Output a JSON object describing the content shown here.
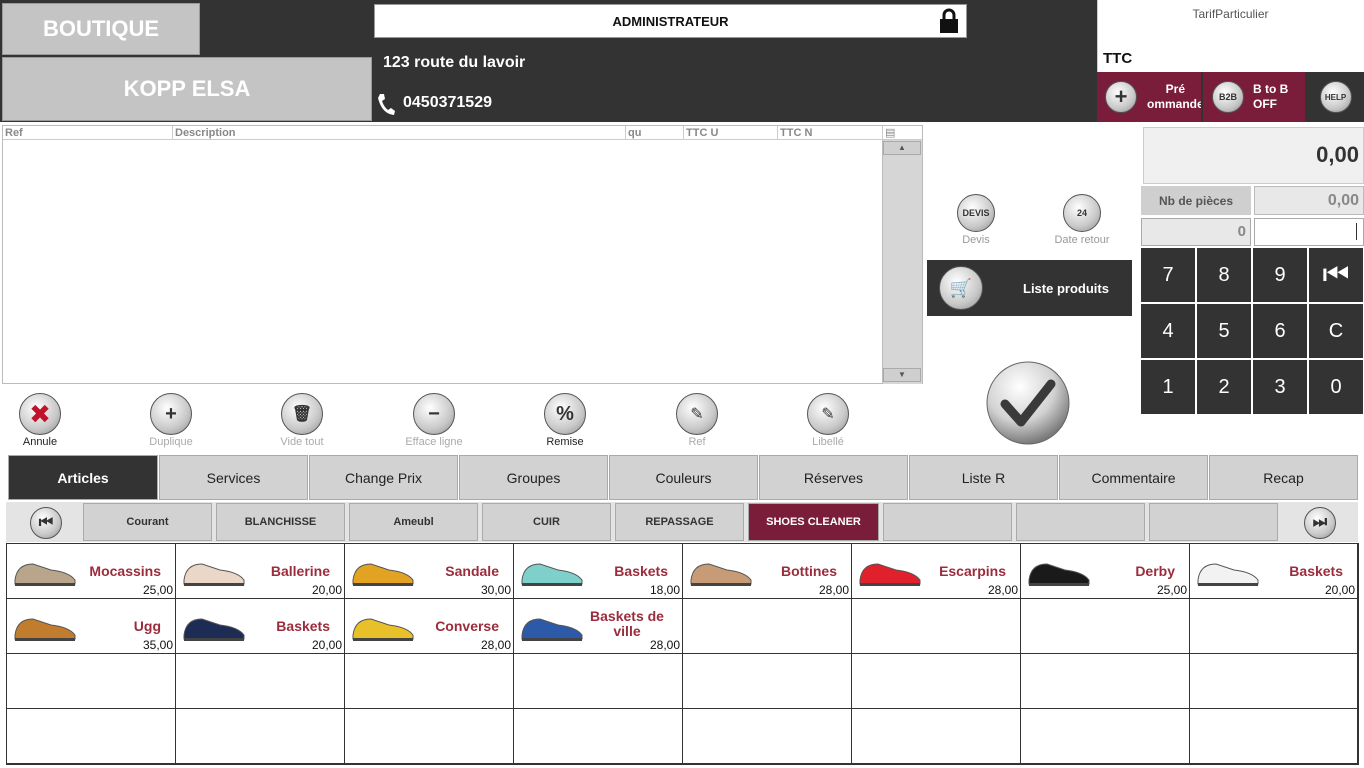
{
  "header": {
    "store": "BOUTIQUE",
    "customer": "KOPP ELSA",
    "user": "ADMINISTRATEUR",
    "address": "123 route du lavoir",
    "phone": "0450371529",
    "tarif": "TarifParticulier",
    "ttc": "TTC",
    "btn_precommande": "Pré\nommande",
    "btn_b2b_line1": "B to B",
    "btn_b2b_line2": "OFF",
    "b2b_icon": "B2B",
    "help_icon": "HELP"
  },
  "grid": {
    "columns": [
      "Ref",
      "Description",
      "qu",
      "TTC U",
      "TTC N"
    ]
  },
  "totals": {
    "total": "0,00",
    "nb_label": "Nb de pièces",
    "nb_value": "0,00",
    "qty": "0"
  },
  "keypad": [
    "7",
    "8",
    "9",
    "⏮",
    "4",
    "5",
    "6",
    "C",
    "1",
    "2",
    "3",
    "0"
  ],
  "mid": {
    "devis_icon": "DEVIS",
    "devis": "Devis",
    "date_retour": "Date retour",
    "date_icon": "24",
    "liste_produits": "Liste produits"
  },
  "actions": [
    "Annule",
    "Duplique",
    "Vide tout",
    "Efface ligne",
    "Remise",
    "Ref",
    "Libellé"
  ],
  "tabs": [
    "Articles",
    "Services",
    "Change Prix",
    "Groupes",
    "Couleurs",
    "Réserves",
    "Liste R",
    "Commentaire",
    "Recap"
  ],
  "subtabs": [
    "Courant",
    "BLANCHISSE",
    "Ameubl",
    "CUIR",
    "REPASSAGE",
    "SHOES CLEANER",
    "",
    "",
    ""
  ],
  "products": [
    {
      "name": "Mocassins",
      "price": "25,00",
      "color": "#b9a58c"
    },
    {
      "name": "Ballerine",
      "price": "20,00",
      "color": "#ead7c8"
    },
    {
      "name": "Sandale",
      "price": "30,00",
      "color": "#e2a322"
    },
    {
      "name": "Baskets",
      "price": "18,00",
      "color": "#7fd0cb"
    },
    {
      "name": "Bottines",
      "price": "28,00",
      "color": "#c79b76"
    },
    {
      "name": "Escarpins",
      "price": "28,00",
      "color": "#e0202a"
    },
    {
      "name": "Derby",
      "price": "25,00",
      "color": "#1a1a1a"
    },
    {
      "name": "Baskets",
      "price": "20,00",
      "color": "#f2f2f2"
    },
    {
      "name": "Ugg",
      "price": "35,00",
      "color": "#c27c2e"
    },
    {
      "name": "Baskets",
      "price": "20,00",
      "color": "#1d2c55"
    },
    {
      "name": "Converse",
      "price": "28,00",
      "color": "#e7c02a"
    },
    {
      "name": "Baskets de ville",
      "price": "28,00",
      "color": "#2d5aa8"
    }
  ]
}
